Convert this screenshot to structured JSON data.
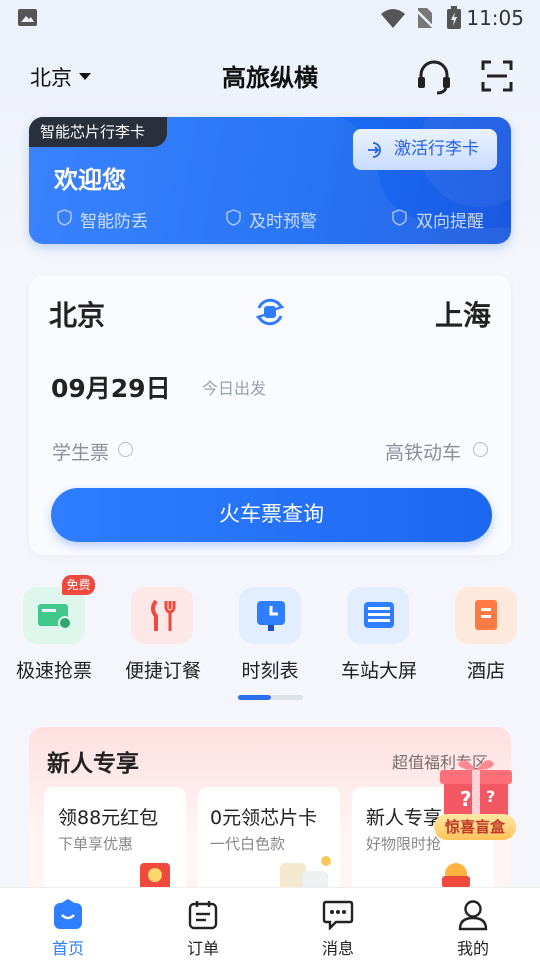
{
  "status_bar": {
    "time": "11:05"
  },
  "header": {
    "city": "北京",
    "title": "高旅纵横"
  },
  "banner": {
    "tag": "智能芯片行李卡",
    "activate_label": "激活行李卡",
    "welcome": "欢迎您",
    "features": [
      "智能防丢",
      "及时预警",
      "双向提醒"
    ]
  },
  "search": {
    "from": "北京",
    "to": "上海",
    "date": "09月29日",
    "date_note": "今日出发",
    "student_ticket": "学生票",
    "high_speed": "高铁动车",
    "button_label": "火车票查询"
  },
  "quick": {
    "badge": "免费",
    "items": [
      {
        "label": "极速抢票",
        "color": "#3ec98b"
      },
      {
        "label": "便捷订餐",
        "color": "#f04a3e"
      },
      {
        "label": "时刻表",
        "color": "#2f7eff"
      },
      {
        "label": "车站大屏",
        "color": "#2f7eff"
      },
      {
        "label": "酒店",
        "color": "#ff7a45"
      }
    ]
  },
  "promo": {
    "title": "新人专享",
    "more": "超值福利专区",
    "gift_badge": "惊喜盲盒",
    "cards": [
      {
        "title": "领88元红包",
        "sub": "下单享优惠"
      },
      {
        "title": "0元领芯片卡",
        "sub": "一代白色款"
      },
      {
        "title": "新人专享",
        "sub": "好物限时抢"
      }
    ]
  },
  "nav": [
    {
      "label": "首页",
      "active": true
    },
    {
      "label": "订单",
      "active": false
    },
    {
      "label": "消息",
      "active": false
    },
    {
      "label": "我的",
      "active": false
    }
  ]
}
